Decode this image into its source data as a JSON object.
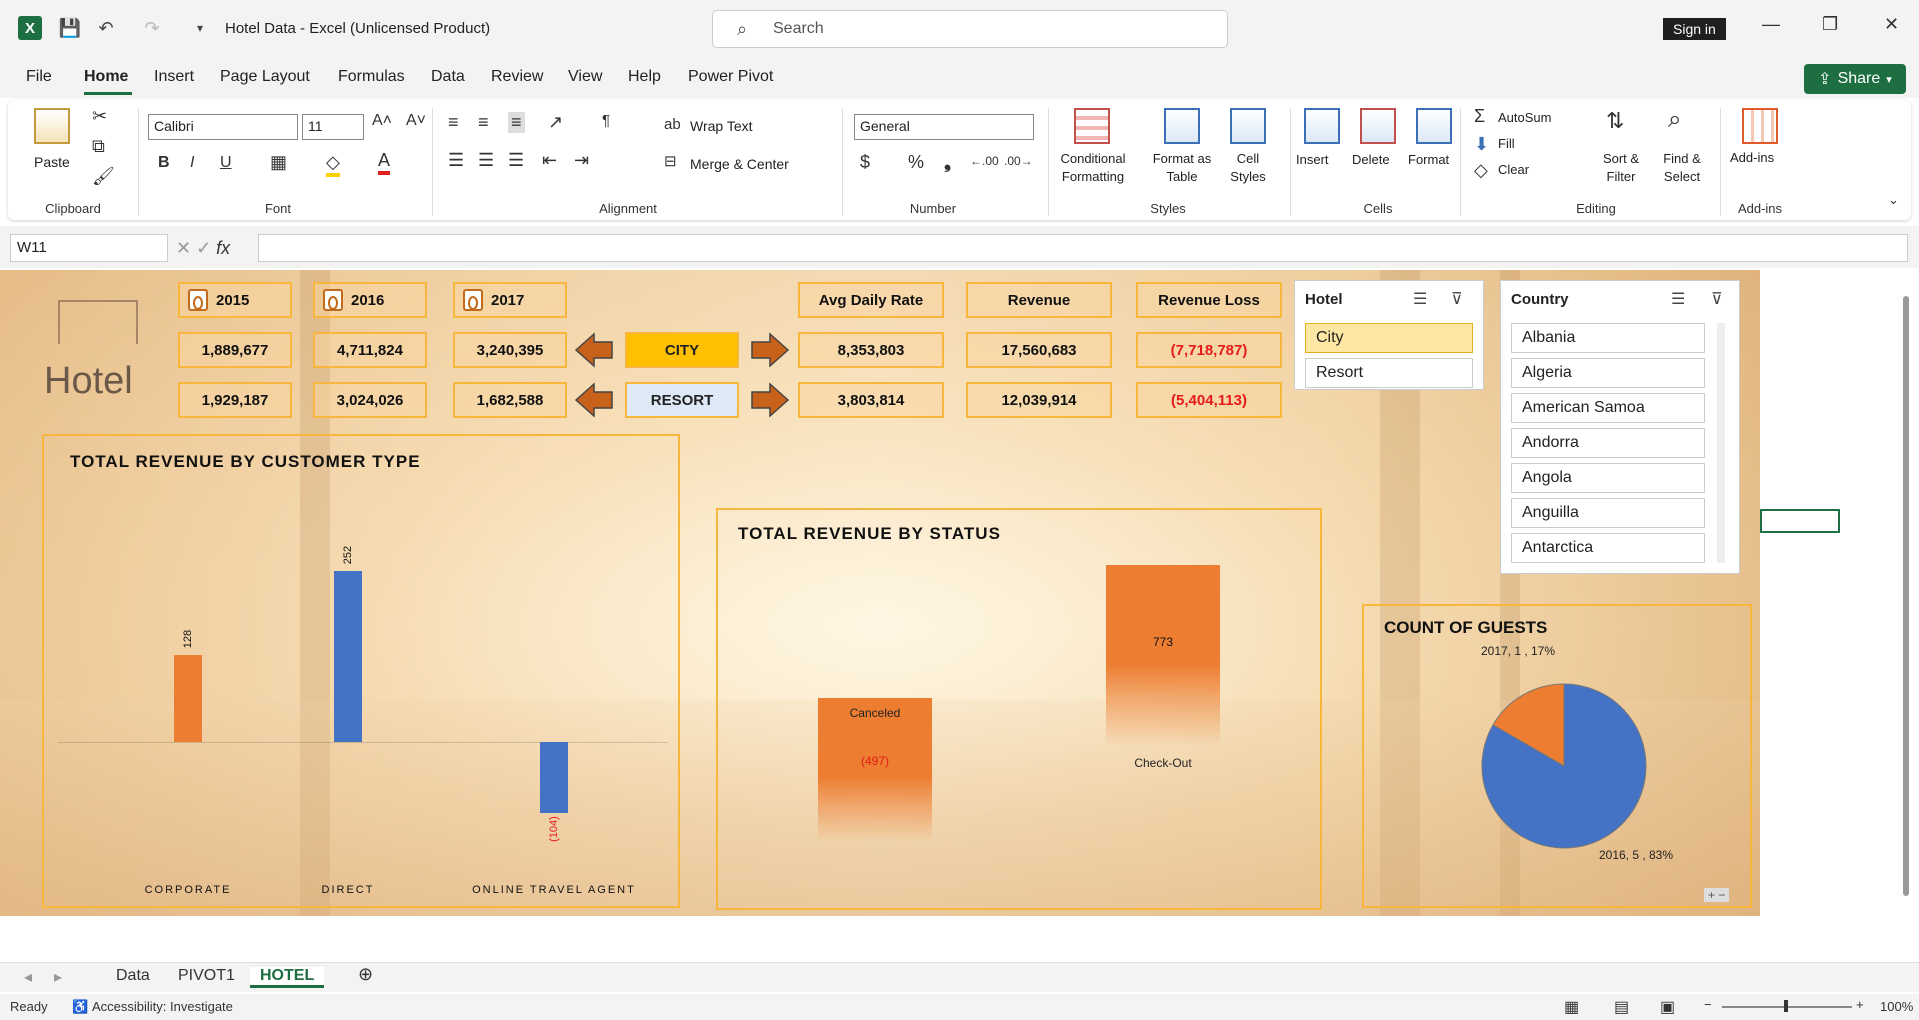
{
  "titlebar": {
    "doc_title": "Hotel Data  -  Excel (Unlicensed Product)",
    "search_placeholder": "Search",
    "sign_in": "Sign in"
  },
  "tabs": [
    "File",
    "Home",
    "Insert",
    "Page Layout",
    "Formulas",
    "Data",
    "Review",
    "View",
    "Help",
    "Power Pivot"
  ],
  "share_label": "Share",
  "ribbon": {
    "clipboard": {
      "paste": "Paste",
      "label": "Clipboard"
    },
    "font": {
      "name": "Calibri",
      "size": "11",
      "label": "Font"
    },
    "alignment": {
      "wrap": "Wrap Text",
      "merge": "Merge & Center",
      "label": "Alignment"
    },
    "number": {
      "format": "General",
      "label": "Number"
    },
    "styles": {
      "cond": "Conditional",
      "cond2": "Formatting",
      "fmt": "Format as",
      "fmt2": "Table",
      "cell": "Cell",
      "cell2": "Styles",
      "label": "Styles"
    },
    "cells": {
      "insert": "Insert",
      "delete": "Delete",
      "format": "Format",
      "label": "Cells"
    },
    "editing": {
      "autosum": "AutoSum",
      "fill": "Fill",
      "clear": "Clear",
      "sort": "Sort &",
      "sort2": "Filter",
      "find": "Find &",
      "find2": "Select",
      "label": "Editing"
    },
    "addins": {
      "addins": "Add-ins",
      "label": "Add-ins"
    }
  },
  "formula_bar": {
    "name_box": "W11",
    "value": ""
  },
  "dashboard": {
    "logo_text": "Hotel",
    "years": [
      "2015",
      "2016",
      "2017"
    ],
    "city_row": [
      "1,889,677",
      "4,711,824",
      "3,240,395"
    ],
    "resort_row": [
      "1,929,187",
      "3,024,026",
      "1,682,588"
    ],
    "city_label": "CITY",
    "resort_label": "RESORT",
    "metric_headers": [
      "Avg Daily Rate",
      "Revenue",
      "Revenue Loss"
    ],
    "city_metrics": [
      "8,353,803",
      "17,560,683",
      "(7,718,787)"
    ],
    "resort_metrics": [
      "3,803,814",
      "12,039,914",
      "(5,404,113)"
    ],
    "colors": {
      "orange": "#ed7d31",
      "blue": "#4472c4",
      "gold": "#f6b73c",
      "neg": "#e51b1b",
      "city_btn": "#ffc000",
      "resort_btn": "#dde9f7"
    }
  },
  "chart_data": [
    {
      "type": "bar",
      "title": "TOTAL REVENUE BY CUSTOMER TYPE",
      "categories": [
        "CORPORATE",
        "DIRECT",
        "ONLINE TRAVEL AGENT"
      ],
      "values": [
        128,
        252,
        -104
      ],
      "labels": [
        "128",
        "252",
        "(104)"
      ]
    },
    {
      "type": "bar",
      "title": "TOTAL REVENUE BY STATUS",
      "categories": [
        "Canceled",
        "Check-Out"
      ],
      "values": [
        -497,
        773
      ],
      "labels": [
        "(497)",
        "773"
      ]
    },
    {
      "type": "pie",
      "title": "COUNT OF GUESTS",
      "slices": [
        {
          "name": "2017",
          "value": 1,
          "label": "2017, 1 , 17%"
        },
        {
          "name": "2016",
          "value": 5,
          "label": "2016, 5 , 83%"
        }
      ]
    }
  ],
  "slicers": {
    "hotel": {
      "title": "Hotel",
      "items": [
        "City",
        "Resort"
      ]
    },
    "country": {
      "title": "Country",
      "items": [
        "Albania",
        "Algeria",
        "American Samoa",
        "Andorra",
        "Angola",
        "Anguilla",
        "Antarctica"
      ]
    }
  },
  "sheet_tabs": [
    "Data",
    "PIVOT1",
    "HOTEL"
  ],
  "status": {
    "ready": "Ready",
    "accessibility": "Accessibility: Investigate",
    "zoom": "100%"
  }
}
